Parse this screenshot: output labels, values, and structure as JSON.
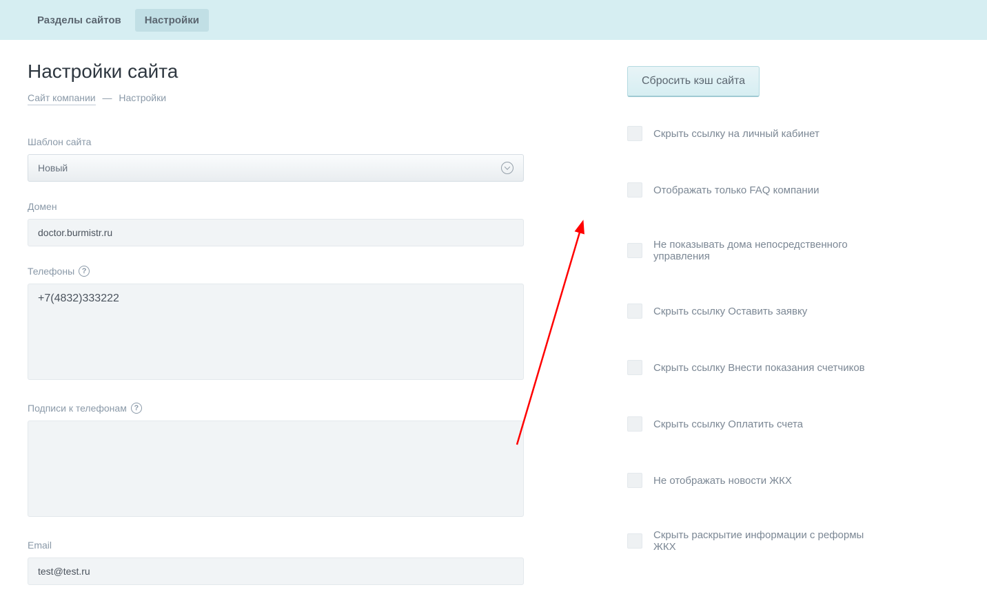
{
  "tabs": {
    "sections": "Разделы сайтов",
    "settings": "Настройки"
  },
  "page": {
    "title": "Настройки сайта",
    "breadcrumb_link": "Сайт компании",
    "breadcrumb_sep": "—",
    "breadcrumb_current": "Настройки"
  },
  "form": {
    "template_label": "Шаблон сайта",
    "template_value": "Новый",
    "domain_label": "Домен",
    "domain_value": "doctor.burmistr.ru",
    "phones_label": "Телефоны",
    "phones_value": "+7(4832)333222",
    "phone_captions_label": "Подписи к телефонам",
    "phone_captions_value": "",
    "email_label": "Email",
    "email_value": "test@test.ru"
  },
  "right": {
    "reset_cache": "Сбросить кэш сайта",
    "checks": [
      "Скрыть ссылку на личный кабинет",
      "Отображать только FAQ компании",
      "Не показывать дома непосредственного управления",
      "Скрыть ссылку Оставить заявку",
      "Скрыть ссылку Внести показания счетчиков",
      "Скрыть ссылку Оплатить счета",
      "Не отображать новости ЖКХ",
      "Скрыть раскрытие информации с реформы ЖКХ"
    ]
  },
  "colors": {
    "topbar_bg": "#d6eef2",
    "text_muted": "#8a99a8",
    "arrow": "#ff0000"
  }
}
